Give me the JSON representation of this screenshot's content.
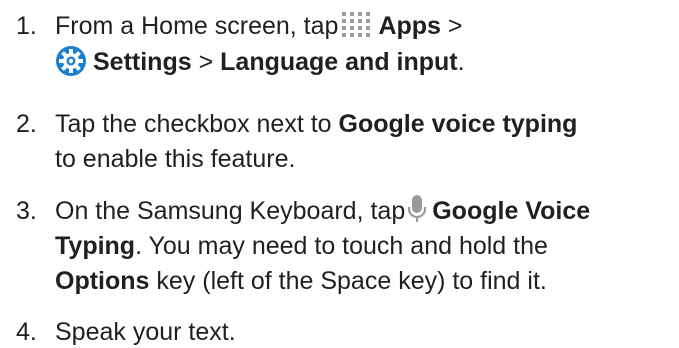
{
  "steps": [
    {
      "number": "1.",
      "lines": [
        {
          "before": "From a Home screen, tap",
          "bold1": "Apps",
          "after": ">"
        },
        {
          "bold1": "Settings",
          "mid": ">",
          "bold2": "Language and input",
          "after": "."
        }
      ],
      "icons": [
        "apps-grid-icon",
        "settings-gear-icon"
      ]
    },
    {
      "number": "2.",
      "lines": [
        {
          "before": "Tap the checkbox next to",
          "bold1": "Google voice typing"
        },
        {
          "before": "to enable this feature."
        }
      ]
    },
    {
      "number": "3.",
      "lines": [
        {
          "before": "On the Samsung Keyboard, tap",
          "bold1": "Google Voice"
        },
        {
          "bold1": "Typing",
          "after": ". You may need to touch and hold the"
        },
        {
          "bold1": "Options",
          "after": "key (left of the Space key) to find it."
        }
      ],
      "icons": [
        "microphone-icon"
      ]
    },
    {
      "number": "4.",
      "lines": [
        {
          "before": "Speak your text."
        }
      ]
    }
  ],
  "colors": {
    "text": "#231f20",
    "icon_blue": "#1a7fd1",
    "icon_gray": "#9a9a9a"
  }
}
